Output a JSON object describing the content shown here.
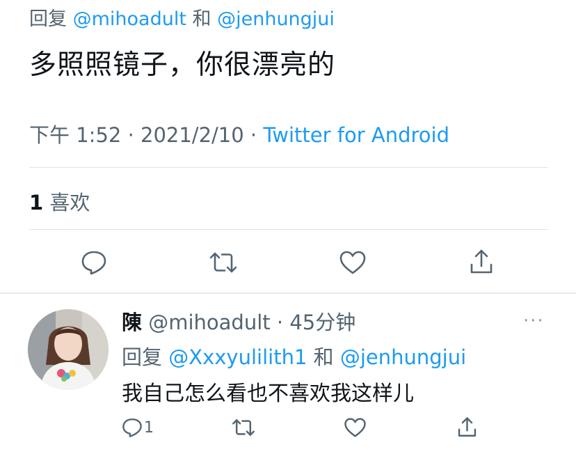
{
  "main_tweet": {
    "reply_prefix": "回复",
    "mention_1": "@mihoadult",
    "conjunction": "和",
    "mention_2": "@jenhungjui",
    "text": "多照照镜子，你很漂亮的",
    "time": "下午 1:52",
    "date": "2021/2/10",
    "separator": "·",
    "source": "Twitter for Android",
    "likes_count": "1",
    "likes_label": "喜欢"
  },
  "reply_tweet": {
    "name": "陳",
    "handle": "@mihoadult",
    "separator": "·",
    "time_ago": "45分钟",
    "more": "···",
    "reply_prefix": "回复",
    "mention_1": "@Xxxyulilith1",
    "conjunction": "和",
    "mention_2": "@jenhungjui",
    "text": "我自己怎么看也不喜欢我这样儿",
    "reply_count": "1"
  },
  "icons": {
    "reply": "reply-icon",
    "retweet": "retweet-icon",
    "like": "heart-icon",
    "share": "share-icon"
  },
  "colors": {
    "accent": "#1d9bf0",
    "text": "#0f1419",
    "secondary": "#536471"
  }
}
